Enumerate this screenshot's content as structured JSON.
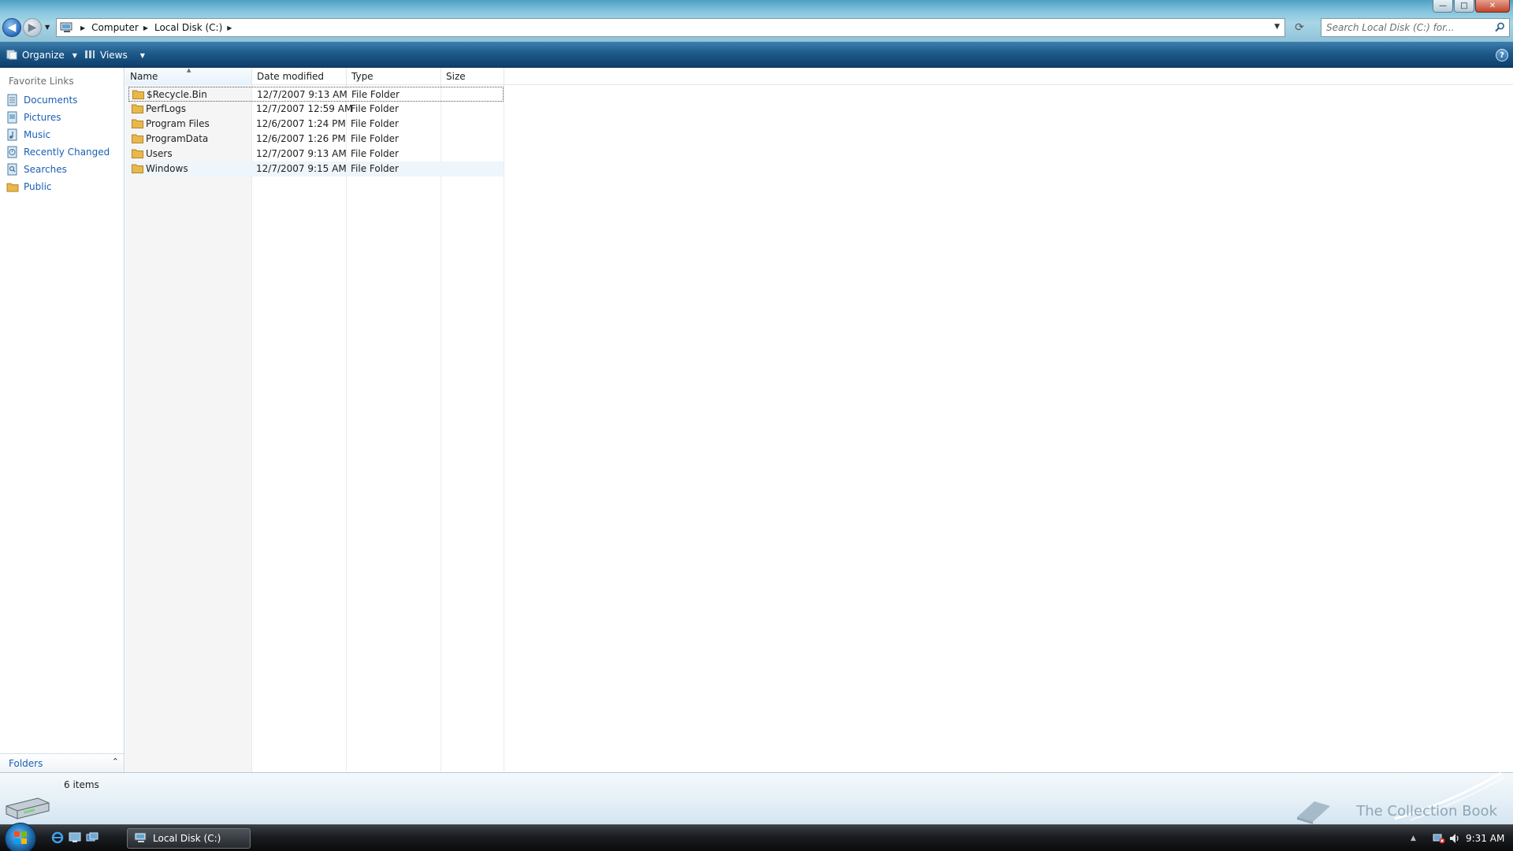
{
  "window": {
    "minimize_glyph": "—",
    "maximize_glyph": "□",
    "close_glyph": "✕"
  },
  "address": {
    "breadcrumbs": [
      "Computer",
      "Local Disk (C:)"
    ],
    "search_placeholder": "Search Local Disk (C:) for..."
  },
  "toolbar": {
    "organize_label": "Organize",
    "views_label": "Views",
    "help_glyph": "?"
  },
  "navpane": {
    "title": "Favorite Links",
    "items": [
      {
        "label": "Documents",
        "icon": "documents-icon"
      },
      {
        "label": "Pictures",
        "icon": "pictures-icon"
      },
      {
        "label": "Music",
        "icon": "music-icon"
      },
      {
        "label": "Recently Changed",
        "icon": "recently-changed-icon"
      },
      {
        "label": "Searches",
        "icon": "searches-icon"
      },
      {
        "label": "Public",
        "icon": "public-folder-icon"
      }
    ],
    "folders_label": "Folders"
  },
  "columns": {
    "name": "Name",
    "date_modified": "Date modified",
    "type": "Type",
    "size": "Size"
  },
  "files": [
    {
      "name": "$Recycle.Bin",
      "date": "12/7/2007 9:13 AM",
      "type": "File Folder",
      "size": ""
    },
    {
      "name": "PerfLogs",
      "date": "12/7/2007 12:59 AM",
      "type": "File Folder",
      "size": ""
    },
    {
      "name": "Program Files",
      "date": "12/6/2007 1:24 PM",
      "type": "File Folder",
      "size": ""
    },
    {
      "name": "ProgramData",
      "date": "12/6/2007 1:26 PM",
      "type": "File Folder",
      "size": ""
    },
    {
      "name": "Users",
      "date": "12/7/2007 9:13 AM",
      "type": "File Folder",
      "size": ""
    },
    {
      "name": "Windows",
      "date": "12/7/2007 9:15 AM",
      "type": "File Folder",
      "size": ""
    }
  ],
  "details": {
    "item_count": "6 items",
    "watermark": "The Collection Book"
  },
  "taskbar": {
    "task_label": "Local Disk (C:)",
    "clock": "9:31 AM"
  },
  "colors": {
    "link_blue": "#1a5fb4",
    "command_bar": "#1e5a8a",
    "folder_yellow": "#e8b84a"
  }
}
